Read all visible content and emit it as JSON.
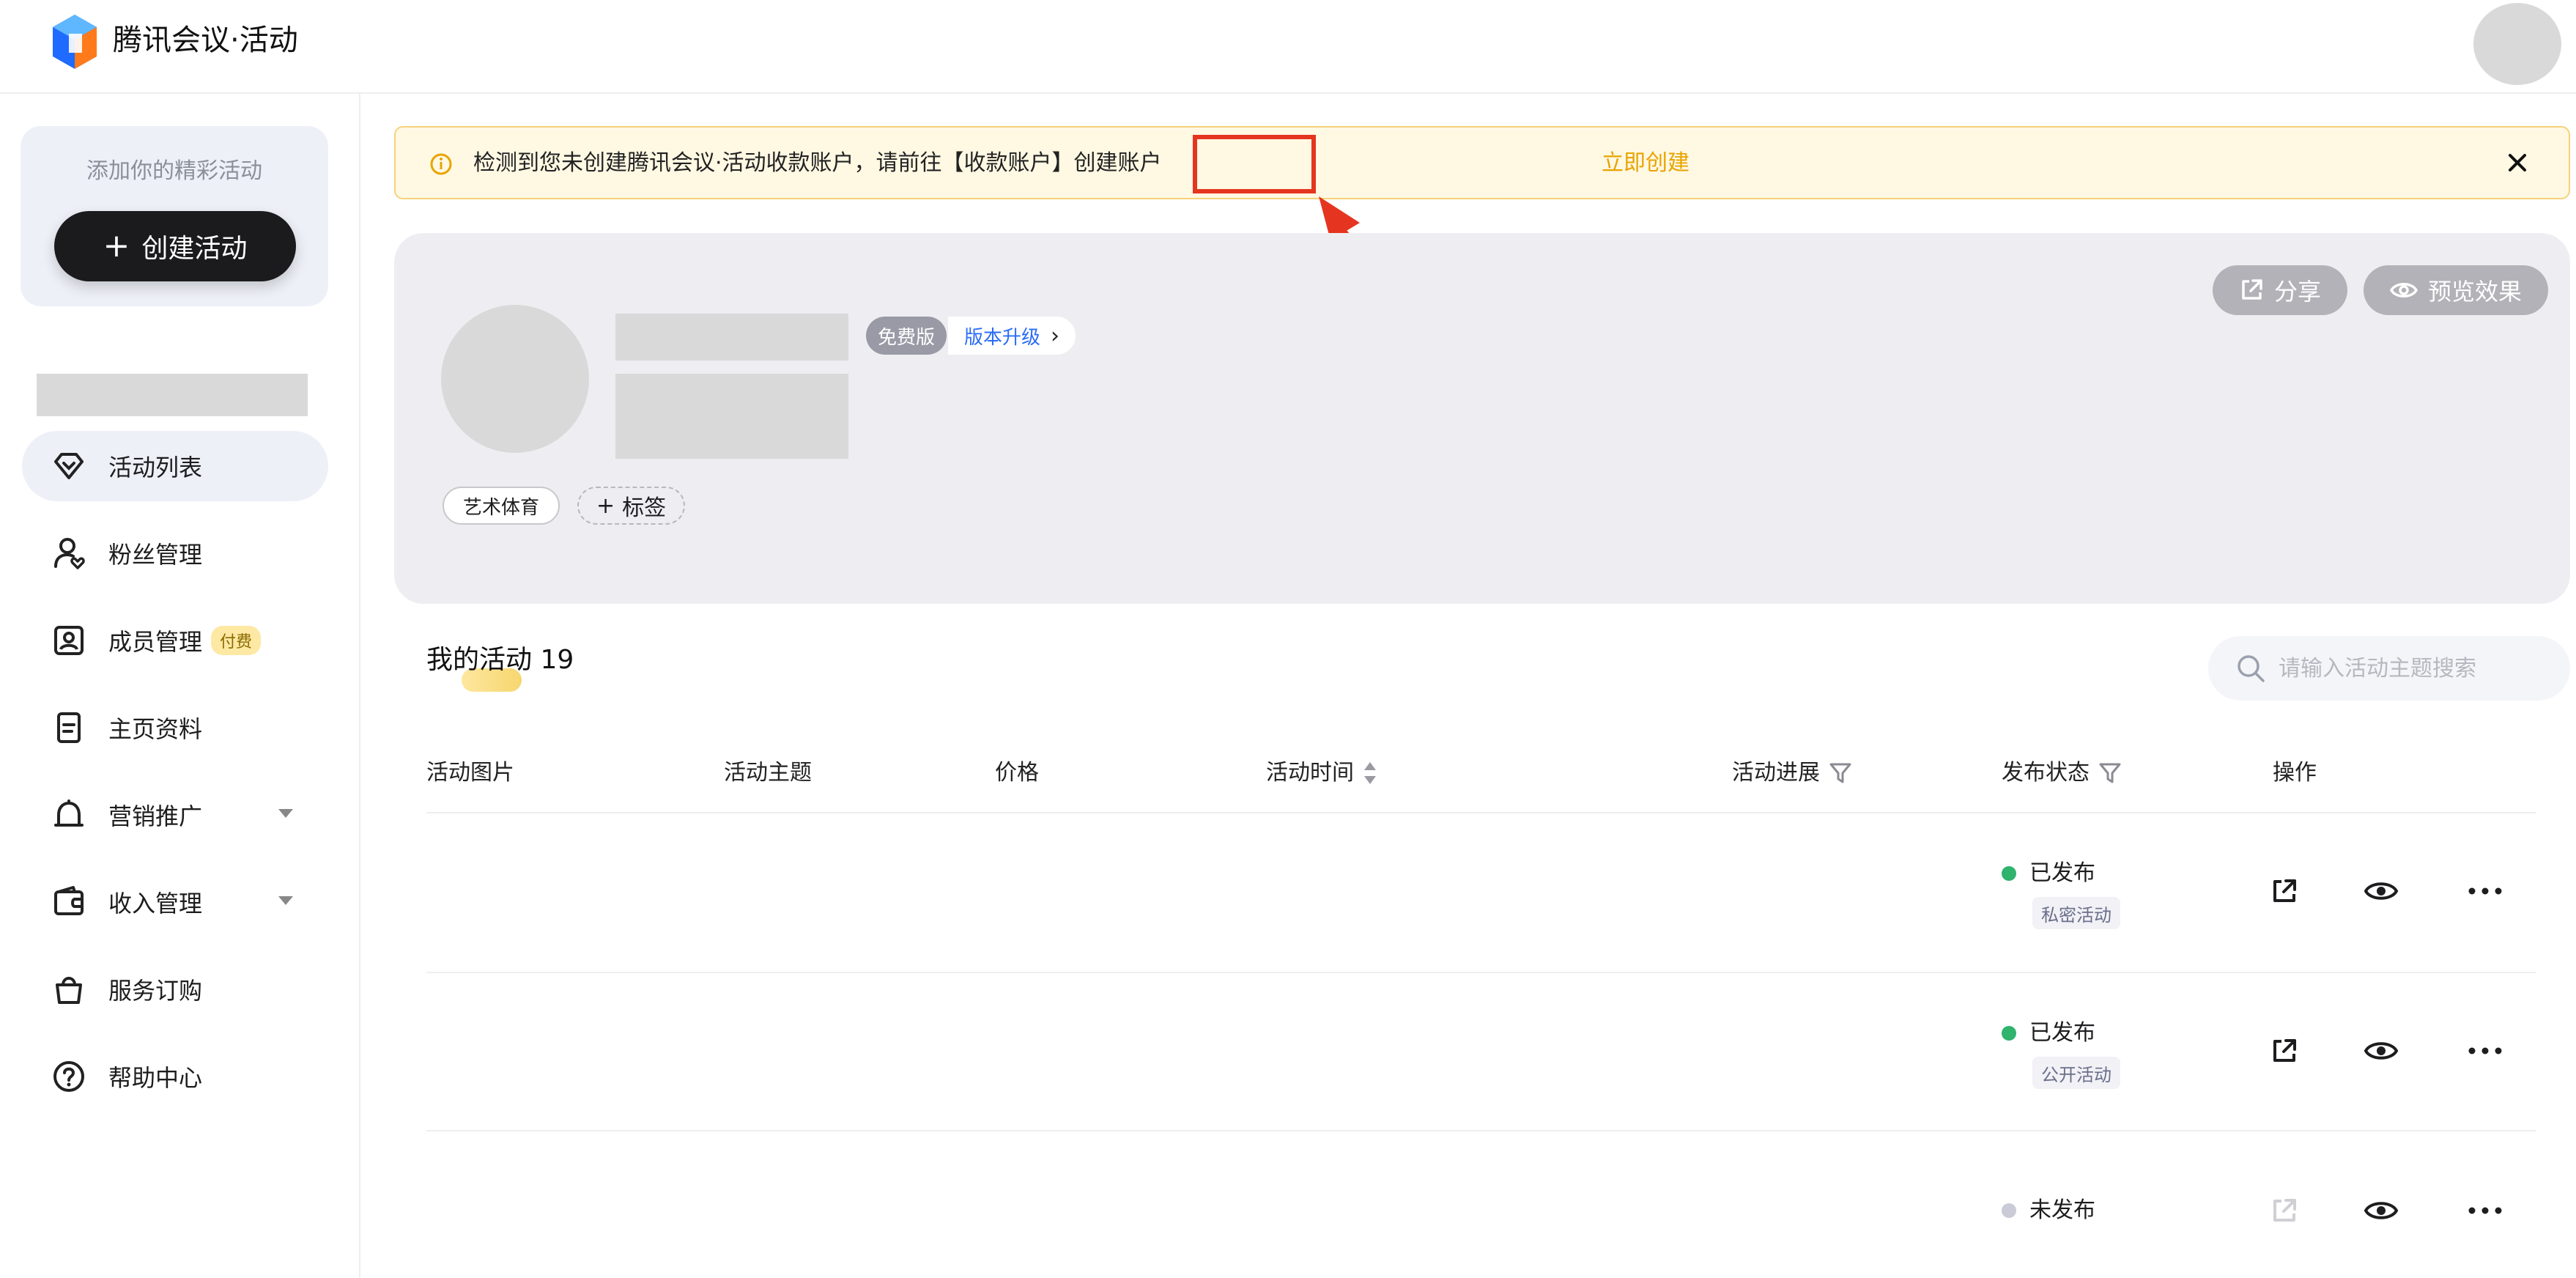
{
  "app": {
    "brand": "腾讯会议·活动"
  },
  "sidebar": {
    "create_hint": "添加你的精彩活动",
    "create_button": "创建活动",
    "items": [
      {
        "label": "活动列表",
        "icon": "diamond-icon",
        "active": true
      },
      {
        "label": "粉丝管理",
        "icon": "user-heart-icon"
      },
      {
        "label": "成员管理",
        "icon": "member-card-icon",
        "badge": "付费"
      },
      {
        "label": "主页资料",
        "icon": "document-icon"
      },
      {
        "label": "营销推广",
        "icon": "megaphone-icon",
        "has_caret": true
      },
      {
        "label": "收入管理",
        "icon": "wallet-icon",
        "has_caret": true
      },
      {
        "label": "服务订购",
        "icon": "shopping-bag-icon"
      },
      {
        "label": "帮助中心",
        "icon": "help-icon"
      }
    ]
  },
  "banner": {
    "message": "检测到您未创建腾讯会议·活动收款账户，请前往【收款账户】创建账户",
    "link": "立即创建"
  },
  "profile": {
    "plan_badge": "免费版",
    "upgrade_label": "版本升级",
    "tag": "艺术体育",
    "add_tag": "标签",
    "share_button": "分享",
    "preview_button": "预览效果"
  },
  "activities": {
    "title": "我的活动",
    "count": "19",
    "search_placeholder": "请输入活动主题搜索",
    "columns": {
      "image": "活动图片",
      "topic": "活动主题",
      "price": "价格",
      "time": "活动时间",
      "progress": "活动进展",
      "status": "发布状态",
      "actions": "操作"
    },
    "rows": [
      {
        "status": "已发布",
        "status_color": "#2fb36d",
        "visibility": "私密活动",
        "share_enabled": true
      },
      {
        "status": "已发布",
        "status_color": "#2fb36d",
        "visibility": "公开活动",
        "share_enabled": true
      },
      {
        "status": "未发布",
        "status_color": "#c9cbd6",
        "visibility": "",
        "share_enabled": false
      }
    ]
  },
  "colors": {
    "accent_dark": "#1b1b1d",
    "link_blue": "#2b6cf6",
    "warning_text": "#e8a400",
    "annotation_red": "#e53520"
  }
}
